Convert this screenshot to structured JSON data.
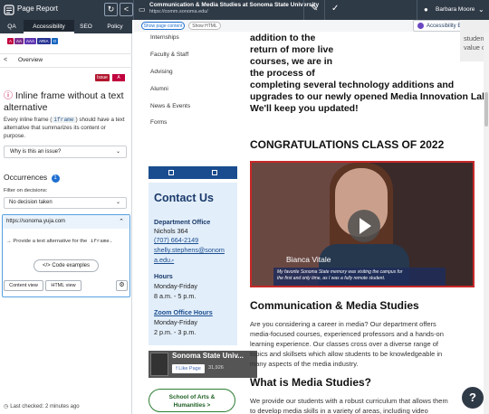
{
  "topbar": {
    "title": "Page Report",
    "refresh_icon": "refresh-icon",
    "share_icon": "share-icon",
    "page_title": "Communication & Media Studies at Sonoma State University",
    "page_url": "https://comm.sonoma.edu/",
    "user_name": "Barbara Moore"
  },
  "panel": {
    "tabs": [
      {
        "label": "QA"
      },
      {
        "label": "Accessibility"
      },
      {
        "label": "SEO"
      },
      {
        "label": "Policy"
      }
    ],
    "badges": [
      "A",
      "AA",
      "AAA",
      "ARIA",
      "O"
    ],
    "overview_label": "Overview",
    "issue_label": "Issue",
    "level_label": "A",
    "issue_title": "Inline frame without a text alternative",
    "issue_desc_before": "Every inline frame (",
    "issue_code": "iframe",
    "issue_desc_after": ") should have a text alternative that summarizes its content or purpose.",
    "why_label": "Why is this an issue?",
    "occurrences_label": "Occurrences",
    "occurrences_count": "1",
    "filter_label": "Filter on decisions:",
    "decision_value": "No decision taken",
    "occurrence_url": "https://sonoma.yuja.com",
    "occurrence_text_before": "Provide a text alternative for the",
    "occurrence_code": "iframe.",
    "code_examples_label": "Code examples",
    "content_view_label": "Content view",
    "html_view_label": "HTML view",
    "last_checked": "Last checked: 2 minutes ago"
  },
  "content": {
    "show_page_content": "Show page content",
    "show_html": "Show HTML",
    "accessibility_explorer": "Accessibility Explorer",
    "nav_items": [
      "Internships",
      "Faculty & Staff",
      "Advising",
      "Alumni",
      "News & Events",
      "Forms"
    ],
    "hero_lines": [
      "addition to the",
      "return of more live",
      "courses, we are in",
      "the process of",
      "completing several technology additions and",
      "upgrades to our newly opened Media Innovation Lab.",
      "We'll keep you updated!"
    ],
    "gray_card_lines": [
      "students and faculty on the",
      "value of internships."
    ],
    "contact": {
      "title": "Contact Us",
      "office_label": "Department Office",
      "office_room": "Nichols 364",
      "phone": "(707) 664-2149",
      "email_line1": "shelly.stephens@sonom",
      "email_line2": "a.edu",
      "hours_label": "Hours",
      "hours_days": "Monday-Friday",
      "hours_time": "8 a.m. - 5 p.m.",
      "zoom_label": "Zoom Office Hours",
      "zoom_days": "Monday-Friday",
      "zoom_time": "2 p.m. - 3 p.m."
    },
    "facebook": {
      "page_name": "Sonoma State Univ...",
      "like_label": "Like Page",
      "like_count": "31,926"
    },
    "school_button_line1": "School of Arts &",
    "school_button_line2": "Humanities  >",
    "congrats_heading": "CONGRATULATIONS CLASS OF 2022",
    "video": {
      "name": "Bianca Vitale",
      "caption_line1": "My favorite Sonoma State memory was visiting the campus for",
      "caption_line2": "the first and only time, as I was a fully remote student."
    },
    "cms_heading": "Communication & Media Studies",
    "cms_lines": [
      "Are you considering a career in media? Our department offers",
      "media-focused courses, experienced professors and a hands-on",
      "learning experience. Our classes cross over a diverse range of",
      "topics and skillsets which allow students to be knowledgeable in",
      "many aspects of the media industry."
    ],
    "what_heading": "What is Media Studies?",
    "what_lines": [
      "We provide our students with a robust curriculum that allows them",
      "to develop media skills in a variety of areas, including video"
    ],
    "help_label": "?"
  },
  "colors": {
    "topbar": "#2f3a47",
    "issue_red": "#b2172e",
    "accent_blue": "#1f6fd1",
    "contact_bg": "#e2eefa",
    "video_border": "#c62828"
  }
}
